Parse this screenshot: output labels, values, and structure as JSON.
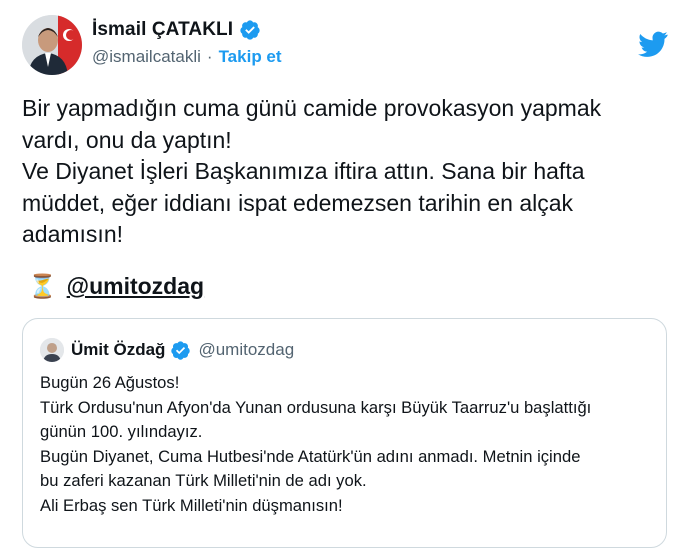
{
  "author": {
    "name": "İsmail ÇATAKLI",
    "handle": "@ismailcatakli",
    "separator": "·",
    "follow_label": "Takip et"
  },
  "tweet": {
    "text": "Bir yapmadığın cuma günü camide provokasyon yapmak\nvardı, onu da yaptın!\nVe Diyanet İşleri Başkanımıza iftira attın. Sana bir hafta\nmüddet, eğer iddianı ispat edemezsen tarihin en alçak\nadamısın!",
    "emoji": "⏳",
    "mention": "@umitozdag"
  },
  "quoted": {
    "name": "Ümit Özdağ",
    "handle": "@umitozdag",
    "text": "Bugün 26 Ağustos!\nTürk Ordusu'nun Afyon'da Yunan ordusuna karşı Büyük Taarruz'u başlattığı\ngünün 100. yılındayız.\nBugün Diyanet, Cuma Hutbesi'nde Atatürk'ün adını anmadı. Metnin içinde\nbu zaferi kazanan Türk Milleti'nin de adı yok.\nAli Erbaş sen Türk Milleti'nin düşmanısın!"
  },
  "icons": {
    "verified": "verified-badge-icon",
    "brand": "twitter-bird-icon"
  },
  "colors": {
    "accent": "#1d9bf0",
    "text": "#0f1419",
    "secondary": "#536471",
    "border": "#cfd9de"
  }
}
